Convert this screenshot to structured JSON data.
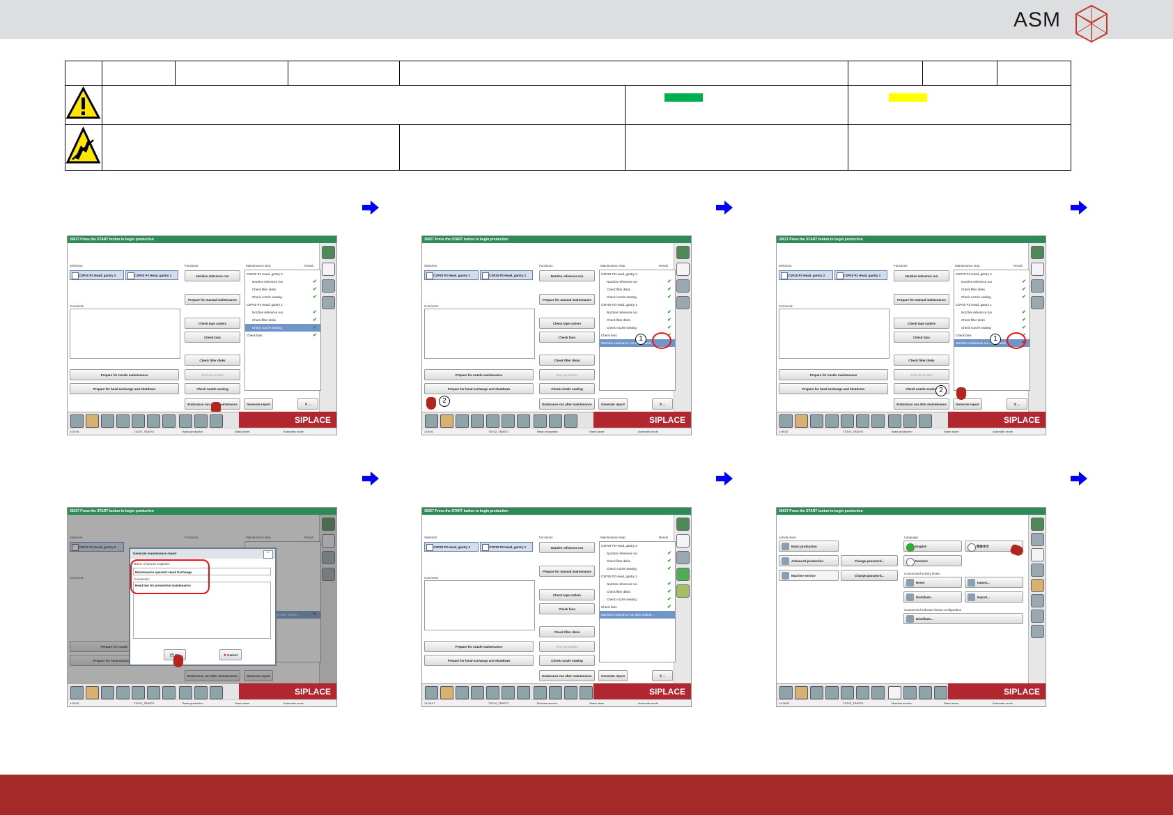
{
  "header": {
    "logo_text": "ASM",
    "colors": {
      "topbar": "#dddee0",
      "footer": "#a52a2a",
      "green_swatch": "#00b050",
      "yellow_swatch": "#ffff00",
      "arrow": "#0000ff"
    }
  },
  "steps": {
    "title_bar_text": "30027 Press the START button to begin production",
    "brand": "SIPLACE",
    "selection_label": "Selection",
    "functions_label": "Functions",
    "comment_label": "Comment:",
    "maintenance_step_label": "Maintenance step",
    "result_label": "Result",
    "head_gantry2": "CSP20 P2 Head, gantry 2",
    "head_gantry1": "CSP20 P2 Head, gantry 1",
    "buttons": {
      "nozzle_ref": "Nozzles reference run",
      "prepare_manual": "Prepare for manual maintenance",
      "check_tape_cutters": "Check tape cutters",
      "check_fans": "Check fans",
      "check_filter_disks": "Check filter disks",
      "pick_up_nozzles": "Pick up nozzles",
      "check_nozzle_seating": "Check nozzle seating",
      "endurance_run": "Endurance run after maintenance",
      "generate_report": "Generate report",
      "prepare_nozzle": "Prepare for nozzle maintenance",
      "prepare_head_exchange": "Prepare for head exchange and shutdown"
    },
    "list_items": {
      "g2": "CSP20 P2 Head, gantry 2",
      "nozzles_ref": "Nozzles reference run",
      "check_filter": "Check filter disks",
      "check_nozzle": "Check nozzle seating",
      "g1": "CSP20 P2 Head, gantry 1",
      "check_fans": "Check fans",
      "endurance": "Machine endurance run after mainte..."
    },
    "status": {
      "time1": "1:03:05",
      "time2": "1:05:02",
      "time3": "1:05:02",
      "time4": "1:05:02",
      "time5": "14:05:47",
      "time6": "14:35:51",
      "station": "TX2V2_TB007G",
      "basic_production": "Basic production",
      "machine_service": "Machine service",
      "stand_alone": "Stand alone",
      "automatic_mode": "Automatic mode"
    },
    "callouts": {
      "one": "1",
      "two": "2"
    },
    "dialog": {
      "title": "Generate maintenance report",
      "engineer_label": "Name of service engineer:",
      "engineer_value": "Maintenance operator Head Exchange",
      "comments_label": "Comments:",
      "comments_value": "Head two for preventive maintenance",
      "ok": "OK",
      "cancel": "Cancel"
    },
    "service": {
      "activity_level": "Activity level",
      "basic_production": "Basic production",
      "advanced_production": "Advanced production",
      "machine_service": "Machine service",
      "change_password": "Change password...",
      "language": "Language",
      "english": "English",
      "chinese": "简体中文",
      "deutsch": "Deutsch",
      "customized_levels": "Customized activity levels",
      "reset": "Reset",
      "import": "Import...",
      "distribute": "Distribute...",
      "export": "Export...",
      "indicator_lamps": "Customized indicator lamps configuration",
      "distribute2": "Distribute..."
    }
  }
}
